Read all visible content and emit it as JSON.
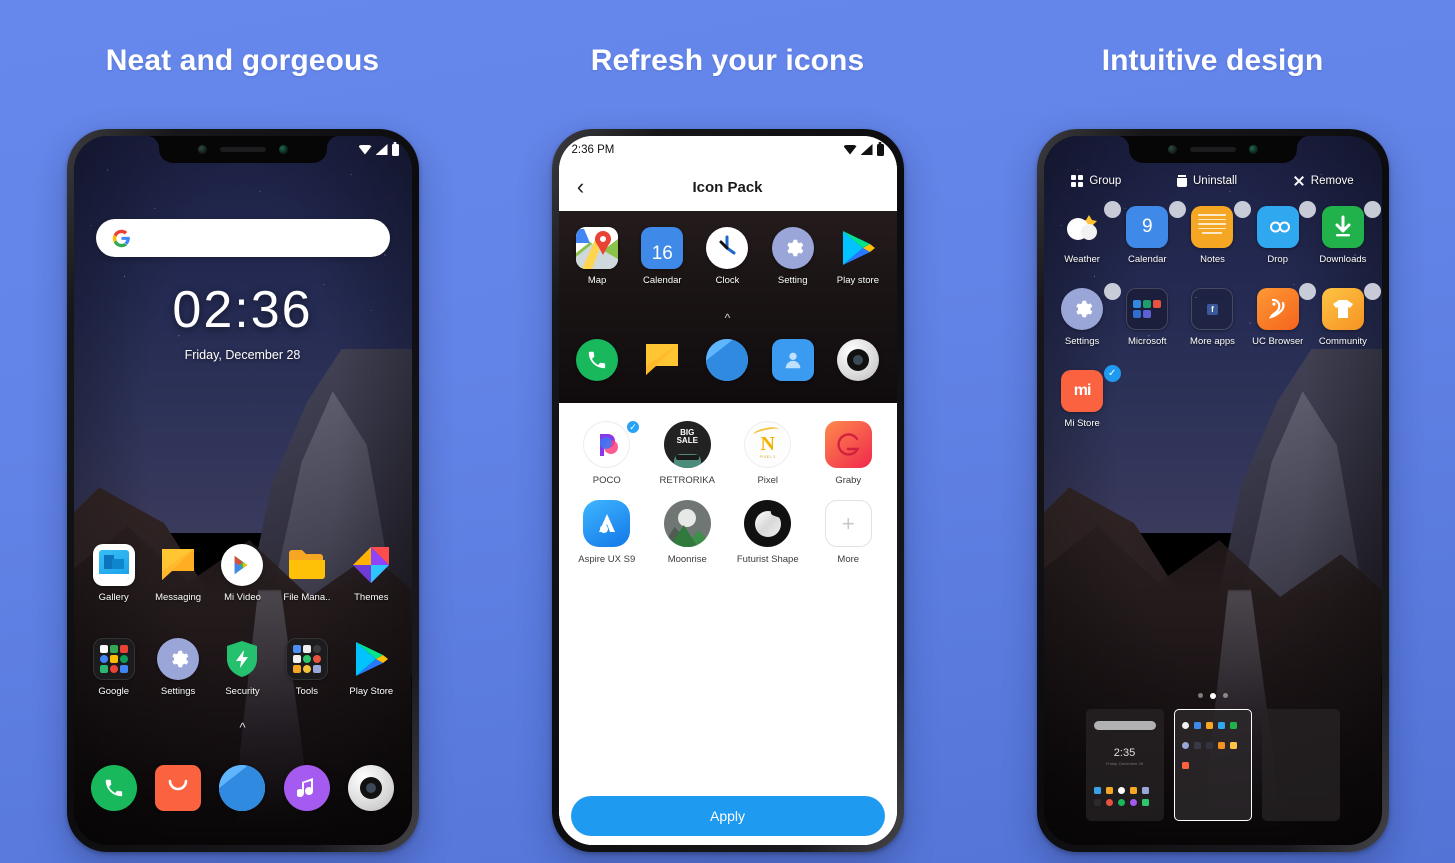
{
  "background": {
    "top_color": "#6688ec",
    "bottom_color": "#5373d6"
  },
  "panels": [
    {
      "title": "Neat and gorgeous"
    },
    {
      "title": "Refresh your icons"
    },
    {
      "title": "Intuitive design"
    }
  ],
  "phone1": {
    "statusbar": {
      "time": "",
      "wifi": "wifi-icon",
      "signal": "signal-icon",
      "battery": "battery-icon"
    },
    "search": {
      "placeholder": "",
      "icon": "google-g-icon"
    },
    "clock": {
      "time": "02:36",
      "date": "Friday, December 28"
    },
    "chevron": "^",
    "row1": [
      {
        "label": "Gallery",
        "icon": "gallery-icon"
      },
      {
        "label": "Messaging",
        "icon": "messaging-icon"
      },
      {
        "label": "Mi Video",
        "icon": "mi-video-icon"
      },
      {
        "label": "File Mana..",
        "icon": "file-manager-icon"
      },
      {
        "label": "Themes",
        "icon": "themes-icon"
      }
    ],
    "row2": [
      {
        "label": "Google",
        "icon": "google-folder-icon"
      },
      {
        "label": "Settings",
        "icon": "settings-icon"
      },
      {
        "label": "Security",
        "icon": "security-icon"
      },
      {
        "label": "Tools",
        "icon": "tools-folder-icon"
      },
      {
        "label": "Play Store",
        "icon": "play-store-icon"
      }
    ],
    "dock": [
      {
        "label": "",
        "icon": "phone-icon"
      },
      {
        "label": "",
        "icon": "mi-store-icon"
      },
      {
        "label": "",
        "icon": "browser-icon"
      },
      {
        "label": "",
        "icon": "music-icon"
      },
      {
        "label": "",
        "icon": "camera-icon"
      }
    ]
  },
  "phone2": {
    "statusbar": {
      "time": "2:36 PM"
    },
    "appbar": {
      "back": "‹",
      "title": "Icon Pack"
    },
    "preview_row1": [
      {
        "label": "Map",
        "icon": "google-maps-icon"
      },
      {
        "label": "Calendar",
        "icon": "calendar-icon",
        "day": "16"
      },
      {
        "label": "Clock",
        "icon": "clock-icon"
      },
      {
        "label": "Setting",
        "icon": "settings-icon"
      },
      {
        "label": "Play store",
        "icon": "play-store-icon"
      }
    ],
    "preview_row2": [
      {
        "label": "",
        "icon": "phone-icon"
      },
      {
        "label": "",
        "icon": "messaging-icon"
      },
      {
        "label": "",
        "icon": "browser-icon"
      },
      {
        "label": "",
        "icon": "contacts-icon"
      },
      {
        "label": "",
        "icon": "camera-icon"
      }
    ],
    "chevron": "^",
    "packs": [
      {
        "label": "POCO",
        "icon": "poco-icon",
        "selected": true
      },
      {
        "label": "RETRORIKA",
        "icon": "retrorika-icon",
        "selected": false
      },
      {
        "label": "Pixel",
        "icon": "pixel-icon",
        "selected": false
      },
      {
        "label": "Graby",
        "icon": "graby-icon",
        "selected": false
      },
      {
        "label": "Aspire UX S9",
        "icon": "aspire-ux-s9-icon",
        "selected": false
      },
      {
        "label": "Moonrise",
        "icon": "moonrise-icon",
        "selected": false
      },
      {
        "label": "Futurist Shape",
        "icon": "futurist-shape-icon",
        "selected": false
      },
      {
        "label": "More",
        "icon": "plus-icon",
        "selected": false
      }
    ],
    "apply_label": "Apply",
    "accent": "#1e9bf0"
  },
  "phone3": {
    "toolbar": [
      {
        "label": "Group",
        "icon": "group-icon"
      },
      {
        "label": "Uninstall",
        "icon": "trash-icon"
      },
      {
        "label": "Remove",
        "icon": "close-icon"
      }
    ],
    "row1": [
      {
        "label": "Weather",
        "icon": "weather-icon"
      },
      {
        "label": "Calendar",
        "icon": "calendar-icon",
        "day": "9"
      },
      {
        "label": "Notes",
        "icon": "notes-icon"
      },
      {
        "label": "Drop",
        "icon": "drop-icon"
      },
      {
        "label": "Downloads",
        "icon": "downloads-icon"
      }
    ],
    "row2": [
      {
        "label": "Settings",
        "icon": "settings-icon"
      },
      {
        "label": "Microsoft",
        "icon": "microsoft-folder-icon"
      },
      {
        "label": "More apps",
        "icon": "more-apps-folder-icon"
      },
      {
        "label": "UC Browser",
        "icon": "uc-browser-icon"
      },
      {
        "label": "Community",
        "icon": "community-icon"
      }
    ],
    "row3": [
      {
        "label": "Mi Store",
        "icon": "mi-store-icon",
        "selected": true
      }
    ],
    "page_dots": {
      "count": 3,
      "active_index": 1
    },
    "thumbnails": [
      {
        "name": "lockscreen-thumb",
        "clock": "2:35",
        "subtitle": "Friday, December 28",
        "active": false
      },
      {
        "name": "homescreen-thumb",
        "clock": "",
        "subtitle": "",
        "active": true
      },
      {
        "name": "empty-page-thumb",
        "clock": "",
        "subtitle": "",
        "active": false
      }
    ]
  }
}
